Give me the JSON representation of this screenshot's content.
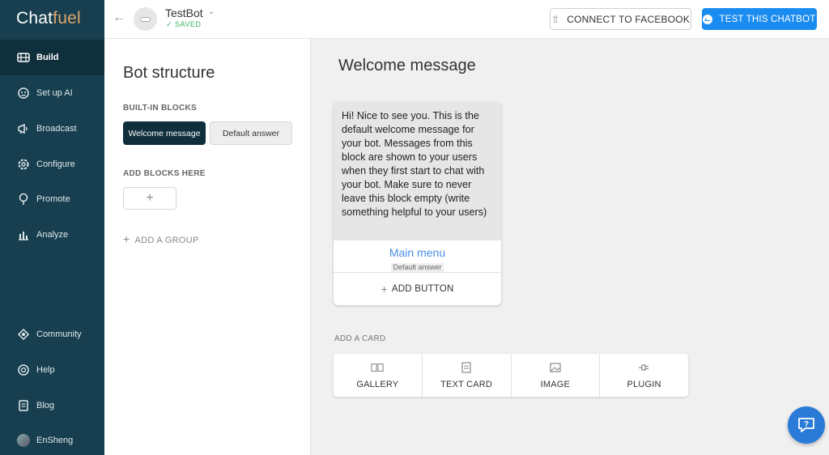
{
  "sidebar": {
    "logo_chat": "Chat",
    "logo_fuel": "fuel",
    "items": [
      {
        "label": "Build",
        "icon": "build-icon"
      },
      {
        "label": "Set up AI",
        "icon": "ai-icon"
      },
      {
        "label": "Broadcast",
        "icon": "broadcast-icon"
      },
      {
        "label": "Configure",
        "icon": "gear-icon"
      },
      {
        "label": "Promote",
        "icon": "promote-icon"
      },
      {
        "label": "Analyze",
        "icon": "chart-icon"
      },
      {
        "label": "Community",
        "icon": "community-icon"
      },
      {
        "label": "Help",
        "icon": "help-icon"
      },
      {
        "label": "Blog",
        "icon": "blog-icon"
      },
      {
        "label": "EnSheng",
        "icon": "user-avatar"
      }
    ]
  },
  "topbar": {
    "bot_name": "TestBot",
    "status": "✓ SAVED",
    "connect_label": "CONNECT TO FACEBOOK",
    "test_label": "TEST THIS CHATBOT"
  },
  "structure": {
    "title": "Bot structure",
    "builtin_label": "BUILT-IN BLOCKS",
    "blocks": [
      "Welcome message",
      "Default answer"
    ],
    "add_blocks_label": "ADD BLOCKS HERE",
    "add_block_symbol": "+",
    "add_group_label": "ADD A GROUP"
  },
  "editor": {
    "title": "Welcome message",
    "card_text": "Hi! Nice to see you. This is the default welcome message for your bot. Messages from this block are shown to your users when they first start to chat with your bot. Make sure to never leave this block empty (write something helpful to your users)",
    "button_title": "Main menu",
    "button_target": "Default answer",
    "add_button_label": "ADD BUTTON",
    "add_card_label": "ADD A CARD",
    "card_types": [
      {
        "label": "GALLERY",
        "icon": "gallery-icon"
      },
      {
        "label": "TEXT CARD",
        "icon": "text-card-icon"
      },
      {
        "label": "IMAGE",
        "icon": "image-icon"
      },
      {
        "label": "PLUGIN",
        "icon": "plugin-icon"
      }
    ]
  },
  "colors": {
    "sidebar_bg": "#173f4f",
    "sidebar_active": "#0f2f3c",
    "accent_blue": "#1a8cf0",
    "saved_green": "#3bb35a",
    "link_blue": "#4a90e2"
  }
}
